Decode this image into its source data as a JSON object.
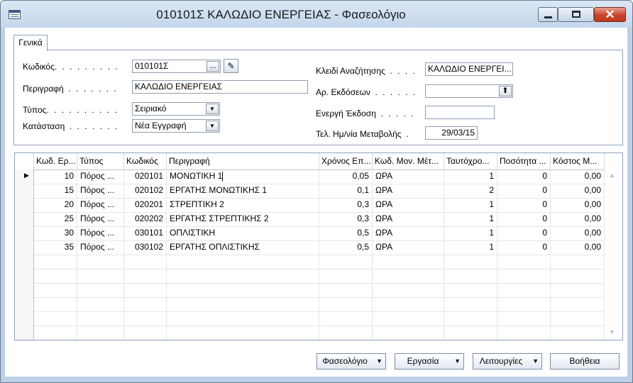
{
  "window": {
    "title": "010101Σ ΚΑΛΩΔΙΟ ΕΝΕΡΓΕΙΑΣ - Φασεολόγιο",
    "minimize": "_",
    "maximize": "□",
    "close": "✕"
  },
  "tabs": [
    {
      "label": "Γενικά",
      "active": true
    }
  ],
  "form": {
    "code_label": "Κωδικός",
    "code_value": "010101Σ",
    "description_label": "Περιγραφή",
    "description_value": "ΚΑΛΩΔΙΟ ΕΝΕΡΓΕΙΑΣ",
    "type_label": "Τύπος",
    "type_value": "Σειριακό",
    "status_label": "Κατάσταση",
    "status_value": "Νέα Εγγραφή",
    "search_key_label": "Κλειδί Αναζήτησης",
    "search_key_value": "ΚΑΛΩΔΙΟ ΕΝΕΡΓΕΙ...",
    "versions_label": "Αρ. Εκδόσεων",
    "versions_value": "",
    "active_version_label": "Ενεργή Έκδοση",
    "active_version_value": "",
    "last_modified_label": "Τελ. Ημ/νία Μεταβολής",
    "last_modified_value": "29/03/15",
    "ellipsis_btn": "...",
    "dots_left": ". . . . . . . . .",
    "dots_desc": ". . . . . . .",
    "dots_type": ". . . . . . . . . .",
    "dots_status": ". . . . . . .",
    "dots_search": ". . . .",
    "dots_versions": ". . . . . .",
    "dots_active": ". . . . .",
    "dots_modified": "."
  },
  "grid": {
    "columns": [
      "Κωδ. Ερ...",
      "Τύπος",
      "Κωδικός",
      "Περιγραφή",
      "Χρόνος Επ...",
      "Κωδ. Μον. Μέτ...",
      "Ταυτόχρο...",
      "Ποσότητα ...",
      "Κόστος Μ..."
    ],
    "rows": [
      [
        "10",
        "Πόρος ...",
        "020101",
        "ΜΟΝΩΤΙΚΗ 1",
        "0,05",
        "ΩΡΑ",
        "1",
        "0",
        "0,00"
      ],
      [
        "15",
        "Πόρος ...",
        "020102",
        "ΕΡΓΑΤΗΣ ΜΟΝΩΤΙΚΗΣ 1",
        "0,1",
        "ΩΡΑ",
        "2",
        "0",
        "0,00"
      ],
      [
        "20",
        "Πόρος ...",
        "020201",
        "ΣΤΡΕΠΤΙΚΗ 2",
        "0,3",
        "ΩΡΑ",
        "1",
        "0",
        "0,00"
      ],
      [
        "25",
        "Πόρος ...",
        "020202",
        "ΕΡΓΑΤΗΣ ΣΤΡΕΠΤΙΚΗΣ 2",
        "0,3",
        "ΩΡΑ",
        "1",
        "0",
        "0,00"
      ],
      [
        "30",
        "Πόρος ...",
        "030101",
        "ΟΠΛΙΣΤΙΚΗ",
        "0,5",
        "ΩΡΑ",
        "1",
        "0",
        "0,00"
      ],
      [
        "35",
        "Πόρος ...",
        "030102",
        "ΕΡΓΑΤΗΣ ΟΠΛΙΣΤΙΚΗΣ",
        "0,5",
        "ΩΡΑ",
        "1",
        "0",
        "0,00"
      ]
    ],
    "current_row_marker": "▶",
    "scroll_up": "▲",
    "scroll_down": "▼"
  },
  "buttons": {
    "phaseology": "Φασεολόγιο",
    "work": "Εργασία",
    "functions": "Λειτουργίες",
    "help": "Βοήθεια",
    "dropdown_arrow": "▼"
  },
  "icons": {
    "pencil": "✎",
    "up_arrow": "⬆",
    "combo_arrow": "▼"
  }
}
